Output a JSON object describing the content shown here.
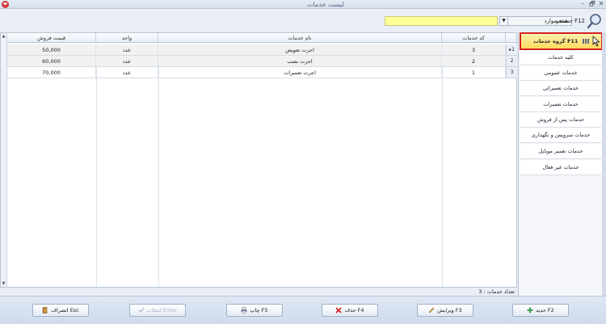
{
  "window": {
    "title": "لیست خدمات",
    "minimize": "–",
    "restore": "🗗",
    "close": "✕"
  },
  "search": {
    "label": "جستجو F12",
    "value": "",
    "filter_value": "همه موارد"
  },
  "grid": {
    "columns": [
      "قیمت فروش",
      "واحد",
      "نام خدمات",
      "کد خدمات"
    ],
    "rows": [
      {
        "index": "1",
        "code": "3",
        "name": "اجرت تعویض",
        "unit": "عدد",
        "price": "50,000"
      },
      {
        "index": "2",
        "code": "2",
        "name": "اجرت نصب",
        "unit": "عدد",
        "price": "60,000"
      },
      {
        "index": "3",
        "code": "1",
        "name": "اجرت تعمیرات",
        "unit": "عدد",
        "price": "70,000"
      }
    ],
    "count_text": "تعداد خدمات : 3"
  },
  "side": {
    "header": "گروه خدمات F11",
    "items": [
      "کلیه خدمات",
      "خدمات عمومی",
      "خدمات تعمیراتی",
      "خدمات تعمیرات",
      "خدمات پس از فروش",
      "خدمات سرویس و نگهداری",
      "خدمات تعمیر موبایل",
      "خدمات غیر فعال"
    ]
  },
  "buttons": {
    "cancel": "انصراف Esc",
    "select": "انتخاب Enter",
    "print": "چاپ F5",
    "delete": "حذف F4",
    "edit": "ویرایش F3",
    "new": "جدید F2"
  },
  "colors": {
    "accent": "#d32222",
    "search_bg": "#ffff99",
    "header_bg": "#ffd95c"
  }
}
